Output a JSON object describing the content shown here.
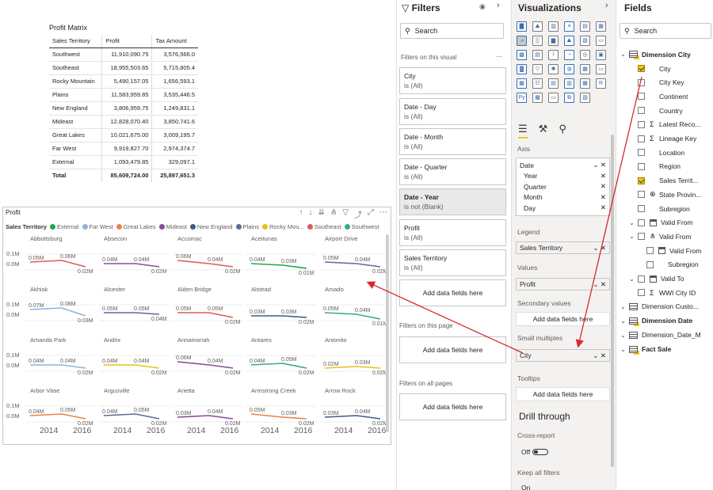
{
  "matrix": {
    "title": "Profit Matrix",
    "headers": [
      "Sales Territory",
      "Profit",
      "Tax Amount"
    ],
    "rows": [
      [
        "Southwest",
        "11,910,090.75",
        "3,576,566.0"
      ],
      [
        "Southeast",
        "18,955,503.65",
        "5,715,805.4"
      ],
      [
        "Rocky Mountain",
        "5,490,157.05",
        "1,656,593.1"
      ],
      [
        "Plains",
        "11,583,959.85",
        "3,535,446.5"
      ],
      [
        "New England",
        "3,806,959.75",
        "1,249,831.1"
      ],
      [
        "Mideast",
        "12,828,070.40",
        "3,850,741.6"
      ],
      [
        "Great Lakes",
        "10,021,675.00",
        "3,009,195.7"
      ],
      [
        "Far West",
        "9,919,827.70",
        "2,974,374.7"
      ],
      [
        "External",
        "1,093,479.85",
        "329,097.1"
      ]
    ],
    "total": [
      "Total",
      "85,609,724.00",
      "25,897,651.3"
    ]
  },
  "visual": {
    "title": "Profit",
    "legend_title": "Sales Territory",
    "legend": [
      {
        "name": "External",
        "color": "#1aab40"
      },
      {
        "name": "Far West",
        "color": "#8ab4e0"
      },
      {
        "name": "Great Lakes",
        "color": "#e8834a"
      },
      {
        "name": "Mideast",
        "color": "#8a4a9a"
      },
      {
        "name": "New England",
        "color": "#3d5d86"
      },
      {
        "name": "Plains",
        "color": "#5a6aa0"
      },
      {
        "name": "Rocky Mou...",
        "color": "#e8c11c"
      },
      {
        "name": "Southeast",
        "color": "#e05a5a"
      },
      {
        "name": "Southwest",
        "color": "#3aa890"
      }
    ],
    "y_labels": [
      "0.1M",
      "0.0M"
    ],
    "x_labels": [
      "2014",
      "2016"
    ],
    "cells": [
      {
        "city": "Abbottsburg",
        "color": "#e05a5a",
        "labels": [
          "0.05M",
          "0.06M",
          "0.02M"
        ]
      },
      {
        "city": "Absecon",
        "color": "#8a4a9a",
        "labels": [
          "0.04M",
          "0.04M",
          "0.02M"
        ]
      },
      {
        "city": "Accomac",
        "color": "#e05a5a",
        "labels": [
          "0.06M",
          "0.04M",
          "0.02M"
        ]
      },
      {
        "city": "Aceitunas",
        "color": "#1aab40",
        "labels": [
          "0.04M",
          "0.03M",
          "0.01M"
        ]
      },
      {
        "city": "Airport Drive",
        "color": "#5a6aa0",
        "labels": [
          "0.05M",
          "0.04M",
          "0.02M"
        ]
      },
      {
        "city": "Akhiok",
        "color": "#8ab4e0",
        "labels": [
          "0.07M",
          "0.08M",
          "0.03M"
        ]
      },
      {
        "city": "Alcester",
        "color": "#5a6aa0",
        "labels": [
          "0.05M",
          "0.05M",
          "0.04M"
        ]
      },
      {
        "city": "Alden Bridge",
        "color": "#e05a5a",
        "labels": [
          "0.05M",
          "0.05M",
          "0.02M"
        ]
      },
      {
        "city": "Alstead",
        "color": "#3d5d86",
        "labels": [
          "0.03M",
          "0.03M",
          "0.02M"
        ]
      },
      {
        "city": "Amado",
        "color": "#3aa890",
        "labels": [
          "0.05M",
          "0.04M",
          "0.01M"
        ]
      },
      {
        "city": "Amanda Park",
        "color": "#8ab4e0",
        "labels": [
          "0.04M",
          "0.04M",
          "0.02M"
        ]
      },
      {
        "city": "Andrix",
        "color": "#e8c11c",
        "labels": [
          "0.04M",
          "0.04M",
          "0.02M"
        ]
      },
      {
        "city": "Annamoriah",
        "color": "#8a4a9a",
        "labels": [
          "0.06M",
          "0.04M",
          "0.02M"
        ]
      },
      {
        "city": "Antares",
        "color": "#3aa890",
        "labels": [
          "0.04M",
          "0.05M",
          "0.02M"
        ]
      },
      {
        "city": "Antonito",
        "color": "#e8c11c",
        "labels": [
          "0.02M",
          "0.03M",
          "0.02M"
        ]
      },
      {
        "city": "Arbor Vitae",
        "color": "#e8834a",
        "labels": [
          "0.04M",
          "0.05M",
          "0.02M"
        ]
      },
      {
        "city": "Argusville",
        "color": "#5a6aa0",
        "labels": [
          "0.04M",
          "0.05M",
          "0.02M"
        ]
      },
      {
        "city": "Arietta",
        "color": "#8a4a9a",
        "labels": [
          "0.03M",
          "0.04M",
          "0.02M"
        ]
      },
      {
        "city": "Armstrong Creek",
        "color": "#e8834a",
        "labels": [
          "0.05M",
          "0.03M",
          "0.02M"
        ]
      },
      {
        "city": "Arrow Rock",
        "color": "#3d5d86",
        "labels": [
          "0.03M",
          "0.04M",
          "0.02M"
        ]
      }
    ]
  },
  "filters": {
    "title": "Filters",
    "search_placeholder": "Search",
    "on_visual": "Filters on this visual",
    "cards": [
      {
        "name": "City",
        "value": "is (All)"
      },
      {
        "name": "Date - Day",
        "value": "is (All)"
      },
      {
        "name": "Date - Month",
        "value": "is (All)"
      },
      {
        "name": "Date - Quarter",
        "value": "is (All)"
      },
      {
        "name": "Date - Year",
        "value": "is not (Blank)"
      },
      {
        "name": "Profit",
        "value": "is (All)"
      },
      {
        "name": "Sales Territory",
        "value": "is (All)"
      }
    ],
    "add_here": "Add data fields here",
    "on_page": "Filters on this page",
    "on_all": "Filters on all pages"
  },
  "viz": {
    "title": "Visualizations",
    "axis": "Axis",
    "axis_items": [
      "Date",
      "Year",
      "Quarter",
      "Month",
      "Day"
    ],
    "legend": "Legend",
    "legend_value": "Sales Territory",
    "values": "Values",
    "values_value": "Profit",
    "secondary": "Secondary values",
    "add_here": "Add data fields here",
    "small_multiples": "Small multiples",
    "sm_value": "City",
    "tooltips": "Tooltips",
    "drill": "Drill through",
    "cross": "Cross-report",
    "off": "Off",
    "keep": "Keep all filters",
    "on": "On"
  },
  "fields": {
    "title": "Fields",
    "search_placeholder": "Search",
    "items": [
      {
        "label": "Dimension City",
        "level": 0,
        "kind": "table",
        "bold": true,
        "chev": "⌄"
      },
      {
        "label": "City",
        "level": 1,
        "kind": "check",
        "checked": true
      },
      {
        "label": "City Key",
        "level": 1,
        "kind": "check"
      },
      {
        "label": "Continent",
        "level": 1,
        "kind": "check"
      },
      {
        "label": "Country",
        "level": 1,
        "kind": "check"
      },
      {
        "label": "Latest Reco...",
        "level": 1,
        "kind": "sigma"
      },
      {
        "label": "Lineage Key",
        "level": 1,
        "kind": "sigma"
      },
      {
        "label": "Location",
        "level": 1,
        "kind": "check"
      },
      {
        "label": "Region",
        "level": 1,
        "kind": "check"
      },
      {
        "label": "Sales Territ...",
        "level": 1,
        "kind": "check",
        "checked": true
      },
      {
        "label": "State Provin...",
        "level": 1,
        "kind": "globe"
      },
      {
        "label": "Subregion",
        "level": 1,
        "kind": "check"
      },
      {
        "label": "Valid From",
        "level": 1,
        "kind": "cal",
        "chev": "⌄"
      },
      {
        "label": "Valid From",
        "level": 1,
        "kind": "hier",
        "chev": "⌄"
      },
      {
        "label": "Valid From",
        "level": 2,
        "kind": "cal"
      },
      {
        "label": "Subregion",
        "level": 2,
        "kind": "check"
      },
      {
        "label": "Valid To",
        "level": 1,
        "kind": "cal",
        "chev": "⌄"
      },
      {
        "label": "WWI City ID",
        "level": 1,
        "kind": "sigma"
      },
      {
        "label": "Dimension Custo...",
        "level": 0,
        "kind": "table",
        "chev": "⌄"
      },
      {
        "label": "Dimension Date",
        "level": 0,
        "kind": "table",
        "bold": true,
        "chev": "⌄"
      },
      {
        "label": "Dimension_Date_M",
        "level": 0,
        "kind": "table",
        "chev": "⌄"
      },
      {
        "label": "Fact Sale",
        "level": 0,
        "kind": "table",
        "bold": true,
        "chev": "⌄"
      }
    ]
  }
}
